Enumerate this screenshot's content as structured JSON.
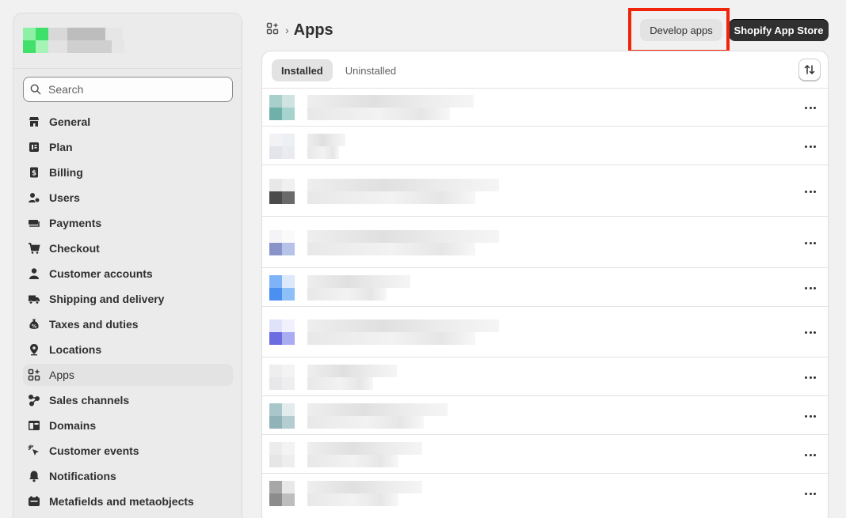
{
  "sidebar": {
    "search": {
      "placeholder": "Search"
    },
    "items": [
      {
        "label": "General",
        "icon": "store-icon"
      },
      {
        "label": "Plan",
        "icon": "plan-icon"
      },
      {
        "label": "Billing",
        "icon": "billing-icon"
      },
      {
        "label": "Users",
        "icon": "users-icon"
      },
      {
        "label": "Payments",
        "icon": "payments-icon"
      },
      {
        "label": "Checkout",
        "icon": "cart-icon"
      },
      {
        "label": "Customer accounts",
        "icon": "person-icon"
      },
      {
        "label": "Shipping and delivery",
        "icon": "truck-icon"
      },
      {
        "label": "Taxes and duties",
        "icon": "tax-icon"
      },
      {
        "label": "Locations",
        "icon": "location-pin-icon"
      },
      {
        "label": "Apps",
        "icon": "apps-icon",
        "active": true
      },
      {
        "label": "Sales channels",
        "icon": "sales-channels-icon"
      },
      {
        "label": "Domains",
        "icon": "globe-icon"
      },
      {
        "label": "Customer events",
        "icon": "cursor-click-icon"
      },
      {
        "label": "Notifications",
        "icon": "bell-icon"
      },
      {
        "label": "Metafields and metaobjects",
        "icon": "metafields-icon"
      }
    ]
  },
  "page": {
    "breadcrumb_separator": "›",
    "title": "Apps"
  },
  "actions": {
    "develop_apps": "Develop apps",
    "app_store": "Shopify App Store"
  },
  "tabs": [
    {
      "label": "Installed",
      "selected": true
    },
    {
      "label": "Uninstalled",
      "selected": false
    }
  ],
  "colors": {
    "highlight": "#f0240a",
    "primary_button": "#303030",
    "active_nav": "#e3e3e3"
  }
}
